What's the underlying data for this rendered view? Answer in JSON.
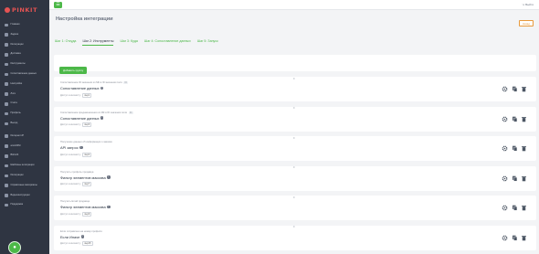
{
  "brand": {
    "logo_text": "PINKIT"
  },
  "sidebar": {
    "items": [
      {
        "label": "Главная"
      },
      {
        "label": "Задачи"
      },
      {
        "label": "Интеграции"
      },
      {
        "label": "Доставка"
      },
      {
        "label": "Инструменты"
      },
      {
        "label": "Сопоставление данных"
      },
      {
        "label": "Настройки"
      },
      {
        "label": "Логи"
      },
      {
        "label": "Счета"
      },
      {
        "label": "Профиль"
      },
      {
        "label": "Выход"
      },
      {
        "label": "Интернет-IP"
      },
      {
        "label": "amoCRM"
      },
      {
        "label": "Bitrix24"
      },
      {
        "label": "Шаблоны интеграции"
      },
      {
        "label": "Интеграции"
      },
      {
        "label": "Справочные материалы"
      },
      {
        "label": "Видеоинструкции"
      },
      {
        "label": "Поддержка"
      }
    ],
    "help_icon": "chat-icon"
  },
  "topbar": {
    "menu_icon": "menu-icon",
    "exit_label": "Выйти"
  },
  "header": {
    "title": "Настройка интеграции",
    "back_label": "Назад"
  },
  "tabs": [
    {
      "label": "Шаг 1: Откуда",
      "active": false
    },
    {
      "label": "Шаг 2: Инструменты",
      "active": true
    },
    {
      "label": "Шаг 3: Куда",
      "active": false
    },
    {
      "label": "Шаг 4: Сопоставление данных",
      "active": false
    },
    {
      "label": "Шаг 5: Запуск",
      "active": false
    }
  ],
  "toolbar": {
    "add_label": "Добавить группу"
  },
  "cards": [
    {
      "subtitle": "Сопоставление ID значения из МК в ID значения поля",
      "pill": "ID",
      "title": "Сопоставление данных",
      "meta_label": "Доступ к контексту:",
      "tag": "step1"
    },
    {
      "subtitle": "Сопоставление предназначения из МК в ID значения поля",
      "pill": "ID",
      "title": "Сопоставление данных",
      "meta_label": "Доступ к контексту:",
      "tag": "step3"
    },
    {
      "subtitle": "Получение данных об информации о заказах",
      "pill": "",
      "title": "API запрос",
      "meta_label": "Доступ к контексту:",
      "tag": "step4"
    },
    {
      "subtitle": "Получить профиль продавца",
      "pill": "",
      "title": "Фильтр элементов массива",
      "meta_label": "Доступ к контексту:",
      "tag": "step7"
    },
    {
      "subtitle": "Получить Email продавца",
      "pill": "",
      "title": "Фильтр элементов массива",
      "meta_label": "Доступ к контексту:",
      "tag": "step9"
    },
    {
      "subtitle": "Если отправлено на номер профиля",
      "pill": "",
      "title": "Если Иначе",
      "meta_label": "Доступ к контексту:",
      "tag": "step15"
    }
  ],
  "colors": {
    "accent": "#4cb848",
    "sidebar_bg": "#2f3542",
    "page_bg": "#f3f4f6",
    "brand": "#e55353",
    "back_border": "#e89a3c"
  }
}
